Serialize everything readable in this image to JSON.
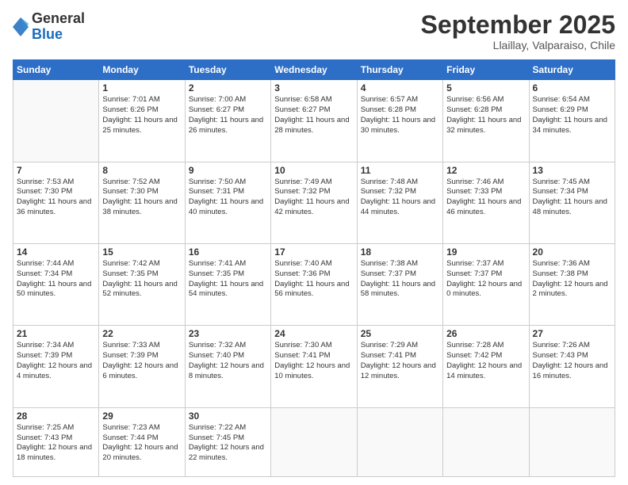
{
  "logo": {
    "general": "General",
    "blue": "Blue"
  },
  "header": {
    "month": "September 2025",
    "location": "Llaillay, Valparaiso, Chile"
  },
  "weekdays": [
    "Sunday",
    "Monday",
    "Tuesday",
    "Wednesday",
    "Thursday",
    "Friday",
    "Saturday"
  ],
  "weeks": [
    [
      {
        "day": "",
        "sunrise": "",
        "sunset": "",
        "daylight": ""
      },
      {
        "day": "1",
        "sunrise": "Sunrise: 7:01 AM",
        "sunset": "Sunset: 6:26 PM",
        "daylight": "Daylight: 11 hours and 25 minutes."
      },
      {
        "day": "2",
        "sunrise": "Sunrise: 7:00 AM",
        "sunset": "Sunset: 6:27 PM",
        "daylight": "Daylight: 11 hours and 26 minutes."
      },
      {
        "day": "3",
        "sunrise": "Sunrise: 6:58 AM",
        "sunset": "Sunset: 6:27 PM",
        "daylight": "Daylight: 11 hours and 28 minutes."
      },
      {
        "day": "4",
        "sunrise": "Sunrise: 6:57 AM",
        "sunset": "Sunset: 6:28 PM",
        "daylight": "Daylight: 11 hours and 30 minutes."
      },
      {
        "day": "5",
        "sunrise": "Sunrise: 6:56 AM",
        "sunset": "Sunset: 6:28 PM",
        "daylight": "Daylight: 11 hours and 32 minutes."
      },
      {
        "day": "6",
        "sunrise": "Sunrise: 6:54 AM",
        "sunset": "Sunset: 6:29 PM",
        "daylight": "Daylight: 11 hours and 34 minutes."
      }
    ],
    [
      {
        "day": "7",
        "sunrise": "Sunrise: 7:53 AM",
        "sunset": "Sunset: 7:30 PM",
        "daylight": "Daylight: 11 hours and 36 minutes."
      },
      {
        "day": "8",
        "sunrise": "Sunrise: 7:52 AM",
        "sunset": "Sunset: 7:30 PM",
        "daylight": "Daylight: 11 hours and 38 minutes."
      },
      {
        "day": "9",
        "sunrise": "Sunrise: 7:50 AM",
        "sunset": "Sunset: 7:31 PM",
        "daylight": "Daylight: 11 hours and 40 minutes."
      },
      {
        "day": "10",
        "sunrise": "Sunrise: 7:49 AM",
        "sunset": "Sunset: 7:32 PM",
        "daylight": "Daylight: 11 hours and 42 minutes."
      },
      {
        "day": "11",
        "sunrise": "Sunrise: 7:48 AM",
        "sunset": "Sunset: 7:32 PM",
        "daylight": "Daylight: 11 hours and 44 minutes."
      },
      {
        "day": "12",
        "sunrise": "Sunrise: 7:46 AM",
        "sunset": "Sunset: 7:33 PM",
        "daylight": "Daylight: 11 hours and 46 minutes."
      },
      {
        "day": "13",
        "sunrise": "Sunrise: 7:45 AM",
        "sunset": "Sunset: 7:34 PM",
        "daylight": "Daylight: 11 hours and 48 minutes."
      }
    ],
    [
      {
        "day": "14",
        "sunrise": "Sunrise: 7:44 AM",
        "sunset": "Sunset: 7:34 PM",
        "daylight": "Daylight: 11 hours and 50 minutes."
      },
      {
        "day": "15",
        "sunrise": "Sunrise: 7:42 AM",
        "sunset": "Sunset: 7:35 PM",
        "daylight": "Daylight: 11 hours and 52 minutes."
      },
      {
        "day": "16",
        "sunrise": "Sunrise: 7:41 AM",
        "sunset": "Sunset: 7:35 PM",
        "daylight": "Daylight: 11 hours and 54 minutes."
      },
      {
        "day": "17",
        "sunrise": "Sunrise: 7:40 AM",
        "sunset": "Sunset: 7:36 PM",
        "daylight": "Daylight: 11 hours and 56 minutes."
      },
      {
        "day": "18",
        "sunrise": "Sunrise: 7:38 AM",
        "sunset": "Sunset: 7:37 PM",
        "daylight": "Daylight: 11 hours and 58 minutes."
      },
      {
        "day": "19",
        "sunrise": "Sunrise: 7:37 AM",
        "sunset": "Sunset: 7:37 PM",
        "daylight": "Daylight: 12 hours and 0 minutes."
      },
      {
        "day": "20",
        "sunrise": "Sunrise: 7:36 AM",
        "sunset": "Sunset: 7:38 PM",
        "daylight": "Daylight: 12 hours and 2 minutes."
      }
    ],
    [
      {
        "day": "21",
        "sunrise": "Sunrise: 7:34 AM",
        "sunset": "Sunset: 7:39 PM",
        "daylight": "Daylight: 12 hours and 4 minutes."
      },
      {
        "day": "22",
        "sunrise": "Sunrise: 7:33 AM",
        "sunset": "Sunset: 7:39 PM",
        "daylight": "Daylight: 12 hours and 6 minutes."
      },
      {
        "day": "23",
        "sunrise": "Sunrise: 7:32 AM",
        "sunset": "Sunset: 7:40 PM",
        "daylight": "Daylight: 12 hours and 8 minutes."
      },
      {
        "day": "24",
        "sunrise": "Sunrise: 7:30 AM",
        "sunset": "Sunset: 7:41 PM",
        "daylight": "Daylight: 12 hours and 10 minutes."
      },
      {
        "day": "25",
        "sunrise": "Sunrise: 7:29 AM",
        "sunset": "Sunset: 7:41 PM",
        "daylight": "Daylight: 12 hours and 12 minutes."
      },
      {
        "day": "26",
        "sunrise": "Sunrise: 7:28 AM",
        "sunset": "Sunset: 7:42 PM",
        "daylight": "Daylight: 12 hours and 14 minutes."
      },
      {
        "day": "27",
        "sunrise": "Sunrise: 7:26 AM",
        "sunset": "Sunset: 7:43 PM",
        "daylight": "Daylight: 12 hours and 16 minutes."
      }
    ],
    [
      {
        "day": "28",
        "sunrise": "Sunrise: 7:25 AM",
        "sunset": "Sunset: 7:43 PM",
        "daylight": "Daylight: 12 hours and 18 minutes."
      },
      {
        "day": "29",
        "sunrise": "Sunrise: 7:23 AM",
        "sunset": "Sunset: 7:44 PM",
        "daylight": "Daylight: 12 hours and 20 minutes."
      },
      {
        "day": "30",
        "sunrise": "Sunrise: 7:22 AM",
        "sunset": "Sunset: 7:45 PM",
        "daylight": "Daylight: 12 hours and 22 minutes."
      },
      {
        "day": "",
        "sunrise": "",
        "sunset": "",
        "daylight": ""
      },
      {
        "day": "",
        "sunrise": "",
        "sunset": "",
        "daylight": ""
      },
      {
        "day": "",
        "sunrise": "",
        "sunset": "",
        "daylight": ""
      },
      {
        "day": "",
        "sunrise": "",
        "sunset": "",
        "daylight": ""
      }
    ]
  ]
}
